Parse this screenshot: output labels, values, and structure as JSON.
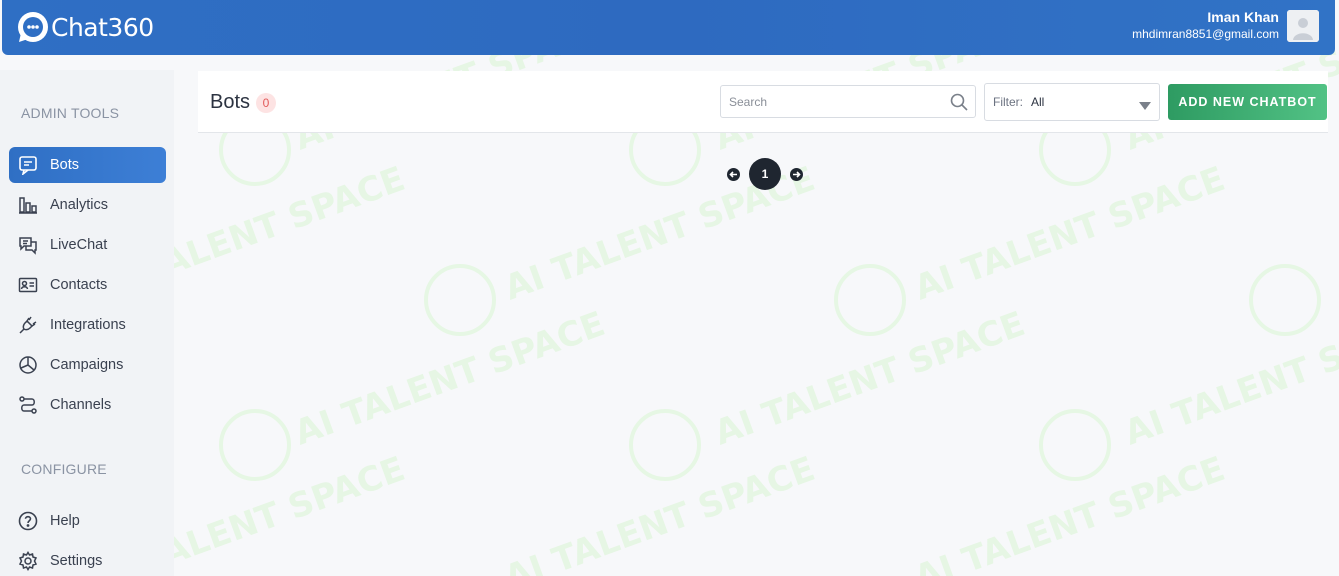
{
  "header": {
    "logo_text": "Chat360",
    "user_name": "Iman Khan",
    "user_email": "mhdimran8851@gmail.com"
  },
  "sidebar": {
    "admin_title": "ADMIN TOOLS",
    "admin_items": [
      {
        "label": "Bots",
        "icon": "bot-chat-icon",
        "active": true
      },
      {
        "label": "Analytics",
        "icon": "bar-chart-icon"
      },
      {
        "label": "LiveChat",
        "icon": "livechat-icon"
      },
      {
        "label": "Contacts",
        "icon": "contact-card-icon"
      },
      {
        "label": "Integrations",
        "icon": "plug-icon"
      },
      {
        "label": "Campaigns",
        "icon": "pie-chart-icon"
      },
      {
        "label": "Channels",
        "icon": "channels-icon"
      }
    ],
    "configure_title": "CONFIGURE",
    "configure_items": [
      {
        "label": "Help",
        "icon": "help-icon"
      },
      {
        "label": "Settings",
        "icon": "gear-icon"
      }
    ]
  },
  "main": {
    "title": "Bots",
    "count": "0",
    "search_placeholder": "Search",
    "filter_label": "Filter:",
    "filter_value": "All",
    "add_button": "ADD NEW CHATBOT",
    "current_page": "1"
  },
  "watermark": {
    "text": "AI TALENT SPACE",
    "color": "#c8f0c0"
  },
  "colors": {
    "brand_blue": "#2f6fc4",
    "add_green": "#3aa86e",
    "badge_red": "#e25a5a"
  }
}
